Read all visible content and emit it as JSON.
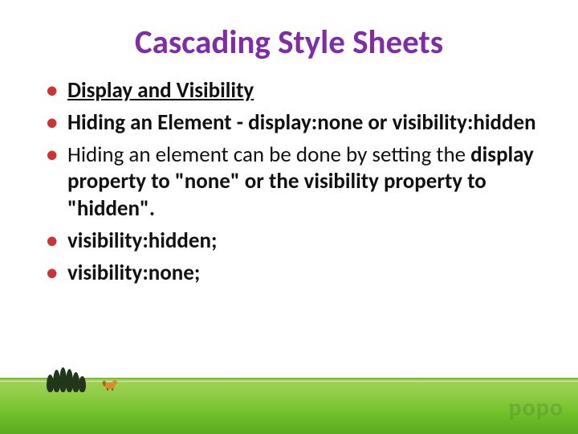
{
  "title": {
    "word1_cap": "C",
    "word1_rest": "ascading ",
    "word2_cap": "S",
    "word2_rest": "tyle ",
    "word3_cap": "S",
    "word3_rest": "heets"
  },
  "bullets": {
    "b1": "Display and Visibility",
    "b2": "Hiding an Element - display:none or visibility:hidden",
    "b3_lead": " Hiding an element can be done by setting the ",
    "b3_bold": "display property to \"none\" or the visibility property to \"hidden\".",
    "b4": "visibility:hidden;",
    "b5": "visibility:none;"
  },
  "watermark": "popo",
  "colors": {
    "title": "#7f2da6",
    "bullet_marker": "#cc3333",
    "grass_top": "#a3d35c",
    "grass_bottom": "#5cab22",
    "tree": "#21361a",
    "animal": "#d98b2e"
  }
}
